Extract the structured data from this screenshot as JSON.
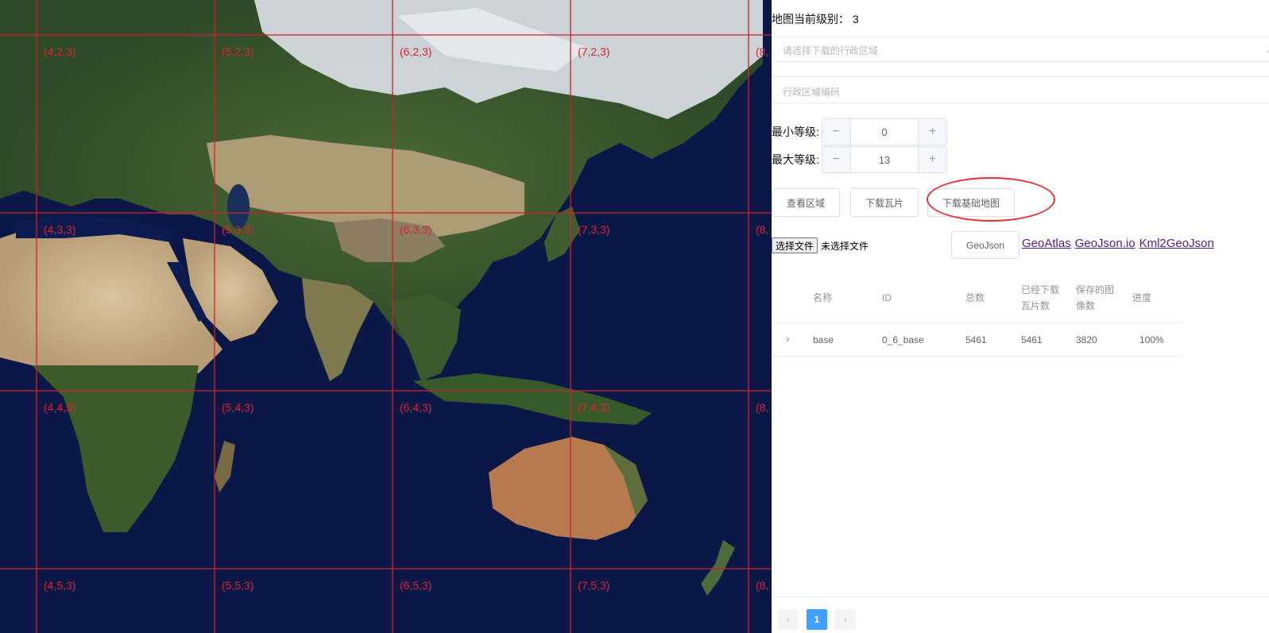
{
  "map": {
    "tile_labels": [
      [
        "(4,2,3)",
        "(5,2,3)",
        "(6,2,3)",
        "(7,2,3)",
        "(8,"
      ],
      [
        "(4,3,3)",
        "(5,3,3)",
        "(6,3,3)",
        "(7,3,3)",
        "(8,"
      ],
      [
        "(4,4,3)",
        "(5,4,3)",
        "(6,4,3)",
        "(7,4,3)",
        "(8,"
      ],
      [
        "(4,5,3)",
        "(5,5,3)",
        "(6,5,3)",
        "(7,5,3)",
        "(8,"
      ]
    ],
    "colors": {
      "ocean": "#0b1847",
      "land": "#3e5a2c",
      "desert": "#c8b48e",
      "snow": "#dfe4ea",
      "grid": "#d0202a"
    }
  },
  "panel": {
    "level_label": "地图当前级别：",
    "level_value": "3",
    "region_placeholder": "请选择下载的行政区域",
    "code_placeholder": "行政区域编码",
    "min_level_label": "最小等级:",
    "min_level_value": "0",
    "max_level_label": "最大等级:",
    "max_level_value": "13",
    "buttons": {
      "view_area": "查看区域",
      "download_tiles": "下载瓦片",
      "download_base_map": "下载基础地图",
      "geojson": "GeoJson"
    },
    "file": {
      "choose": "选择文件",
      "none": "未选择文件"
    },
    "links": [
      "GeoAtlas",
      "GeoJson.io",
      "Kml2GeoJson"
    ],
    "table": {
      "headers": {
        "name": "名称",
        "id": "ID",
        "total": "总数",
        "downloaded_1": "已经下载",
        "downloaded_2": "瓦片数",
        "saved_1": "保存的图",
        "saved_2": "像数",
        "progress": "进度"
      },
      "rows": [
        {
          "name": "base",
          "id": "0_6_base",
          "total": "5461",
          "downloaded": "5461",
          "saved": "3820",
          "progress": "100%"
        }
      ]
    },
    "pager": {
      "current": "1"
    }
  }
}
